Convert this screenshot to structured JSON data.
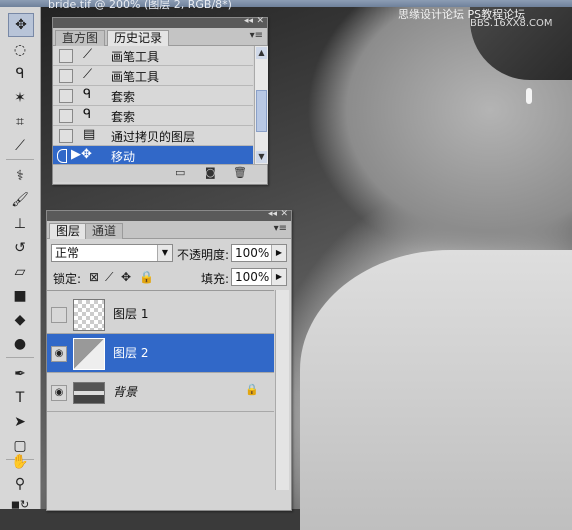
{
  "document": {
    "title": "bride.tif @ 200% (图层 2, RGB/8*)"
  },
  "watermark": {
    "line1": "思缘设计论坛",
    "line2": "PS教程论坛",
    "line3": "BBS.16XX8.COM"
  },
  "history_panel": {
    "tabs": [
      "直方图",
      "历史记录"
    ],
    "active_tab": "历史记录",
    "items": [
      {
        "icon": "brush-icon",
        "label": "画笔工具"
      },
      {
        "icon": "brush-icon",
        "label": "画笔工具"
      },
      {
        "icon": "lasso-icon",
        "label": "套索"
      },
      {
        "icon": "lasso-icon",
        "label": "套索"
      },
      {
        "icon": "layer-copy-icon",
        "label": "通过拷贝的图层"
      },
      {
        "icon": "move-icon",
        "label": "移动",
        "selected": true
      }
    ]
  },
  "layers_panel": {
    "tabs": [
      "图层",
      "通道"
    ],
    "active_tab": "图层",
    "blend_mode": "正常",
    "opacity_label": "不透明度:",
    "opacity_value": "100%",
    "lock_label": "锁定:",
    "fill_label": "填充:",
    "fill_value": "100%",
    "layers": [
      {
        "name": "图层 1",
        "visible": false,
        "selected": false
      },
      {
        "name": "图层 2",
        "visible": true,
        "selected": true
      },
      {
        "name": "背景",
        "visible": true,
        "selected": false,
        "locked": true
      }
    ]
  },
  "colors": {
    "selection": "#3168c8",
    "panel": "#d4d4d4"
  }
}
